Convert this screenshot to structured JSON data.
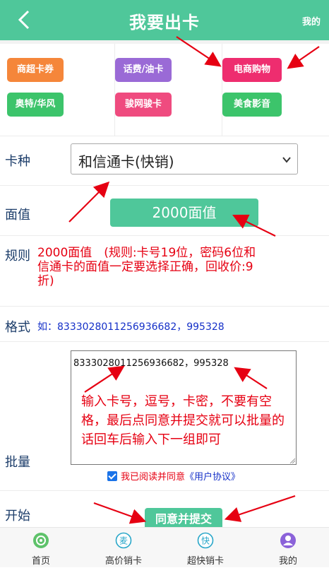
{
  "header": {
    "title": "我要出卡",
    "right_link": "我的"
  },
  "categories": [
    {
      "label": "商超卡券",
      "color": "#f5863a"
    },
    {
      "label": "话费/油卡",
      "color": "#9a6ad6"
    },
    {
      "label": "电商购物",
      "color": "#ee2d6f"
    },
    {
      "label": "奥特/华风",
      "color": "#3cc46b"
    },
    {
      "label": "骏网骏卡",
      "color": "#ef4b7f"
    },
    {
      "label": "美食影音",
      "color": "#3cc46b"
    }
  ],
  "form": {
    "card_type_label": "卡种",
    "card_type_value": "和信通卡(快销)",
    "face_value_label": "面值",
    "face_value_button": "2000面值",
    "rule_label": "规则",
    "rule_text": "2000面值　(规则:卡号19位，密码6位和信通卡的面值一定要选择正确，回收价:9折)",
    "format_label": "格式",
    "format_text": "如：8333028011256936682，995328",
    "batch_label": "批量",
    "batch_value": "8333028011256936682，995328",
    "batch_hint": "输入卡号，逗号，卡密，不要有空格，最后点同意并提交就可以批量的话回车后输入下一组即可",
    "agree_text": "我已阅读并同意",
    "agree_link": "《用户协议》",
    "start_label": "开始",
    "submit_button": "同意并提交"
  },
  "tabbar": [
    {
      "label": "首页",
      "icon": "home-icon",
      "color": "#5ec26a"
    },
    {
      "label": "高价销卡",
      "icon": "sell-icon",
      "color": "#2aa7c9"
    },
    {
      "label": "超快销卡",
      "icon": "fast-icon",
      "color": "#2aa7c9"
    },
    {
      "label": "我的",
      "icon": "user-icon",
      "color": "#8b62d9"
    }
  ],
  "colors": {
    "accent": "#4fc79a",
    "annotation_red": "#e60012",
    "link_blue": "#1530c8"
  }
}
